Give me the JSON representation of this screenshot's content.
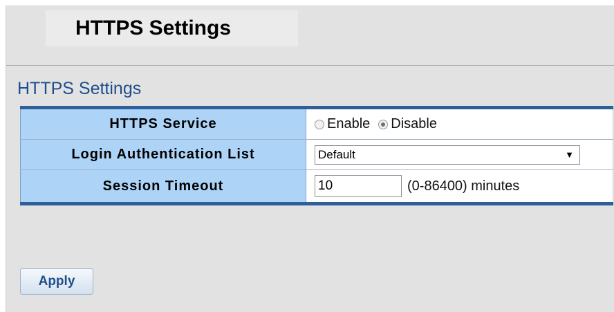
{
  "page": {
    "title": "HTTPS Settings"
  },
  "section": {
    "title": "HTTPS Settings"
  },
  "rows": {
    "https_service": {
      "label": "HTTPS Service",
      "options": [
        {
          "label": "Enable",
          "checked": false
        },
        {
          "label": "Disable",
          "checked": true
        }
      ]
    },
    "login_auth_list": {
      "label": "Login Authentication List",
      "selected": "Default"
    },
    "session_timeout": {
      "label": "Session Timeout",
      "value": "10",
      "hint": "(0-86400) minutes"
    }
  },
  "actions": {
    "apply_label": "Apply"
  },
  "colors": {
    "label_bg": "#add3f7",
    "table_border": "#2f5f98",
    "section_title": "#1f4e8c",
    "page_bg": "#e2e2e2"
  }
}
